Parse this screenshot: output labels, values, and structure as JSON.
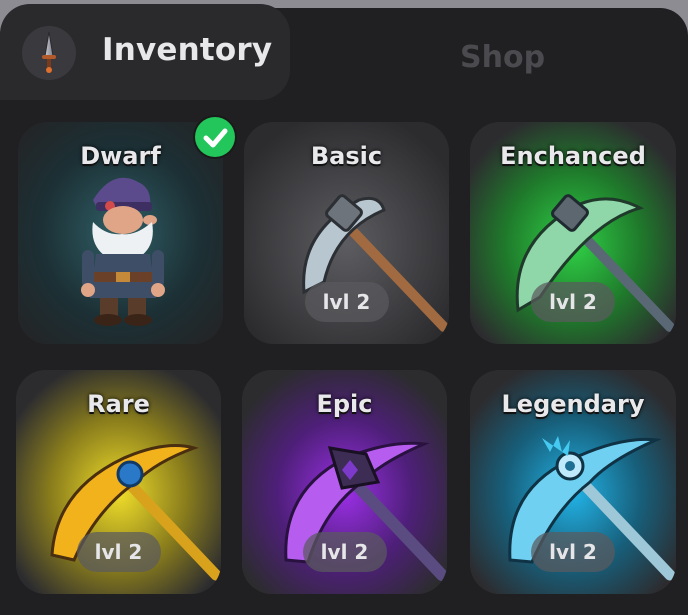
{
  "tabs": {
    "inventory": {
      "label": "Inventory",
      "icon": "dagger-icon",
      "active": true
    },
    "shop": {
      "label": "Shop",
      "active": false
    }
  },
  "cards": [
    {
      "title": "Dwarf",
      "kind": "character",
      "selected": true,
      "icon": "dwarf-character-icon",
      "level": ""
    },
    {
      "title": "Basic",
      "kind": "pickaxe",
      "level": "lvl 2",
      "icon": "basic-pickaxe-icon",
      "glow": "#5a5a5e"
    },
    {
      "title": "Enchanced",
      "kind": "pickaxe",
      "level": "lvl 2",
      "icon": "enchanced-pickaxe-icon",
      "glow": "#22b33a"
    },
    {
      "title": "Rare",
      "kind": "pickaxe",
      "level": "lvl 2",
      "icon": "rare-pickaxe-icon",
      "glow": "#d9c21a"
    },
    {
      "title": "Epic",
      "kind": "pickaxe",
      "level": "lvl 2",
      "icon": "epic-pickaxe-icon",
      "glow": "#8a2fd0"
    },
    {
      "title": "Legendary",
      "kind": "pickaxe",
      "level": "lvl 2",
      "icon": "legendary-pickaxe-icon",
      "glow": "#1f9fcf"
    }
  ],
  "colors": {
    "background": "#202022",
    "card": "#2c2c2f",
    "selected_check": "#22c65b",
    "tab_active": "#2a2a2d"
  }
}
